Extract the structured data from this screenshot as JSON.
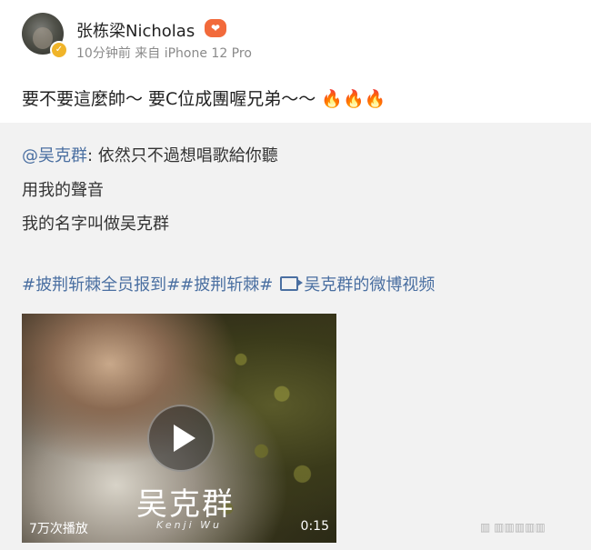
{
  "author": {
    "name": "张栋梁Nicholas",
    "meta": "10分钟前 来自 iPhone 12 Pro"
  },
  "post": {
    "text": "要不要這麼帥～ 要C位成團喔兄弟～～",
    "emoji": "🔥🔥🔥"
  },
  "repost": {
    "mention": "@吴克群",
    "line1": ": 依然只不過想唱歌給你聽",
    "line2": "用我的聲音",
    "line3": "我的名字叫做吴克群",
    "tag1": "#披荆斩棘全员报到#",
    "tag2": "#披荆斩棘#",
    "video_link": "吴克群的微博视频"
  },
  "video": {
    "watermark_cn": "吴克群",
    "watermark_en": "Kenji Wu",
    "play_count": "7万次播放",
    "duration": "0:15"
  },
  "icons": {
    "verified": "verified-badge-icon",
    "member": "member-badge-icon",
    "video": "video-camera-icon",
    "play": "play-icon"
  }
}
